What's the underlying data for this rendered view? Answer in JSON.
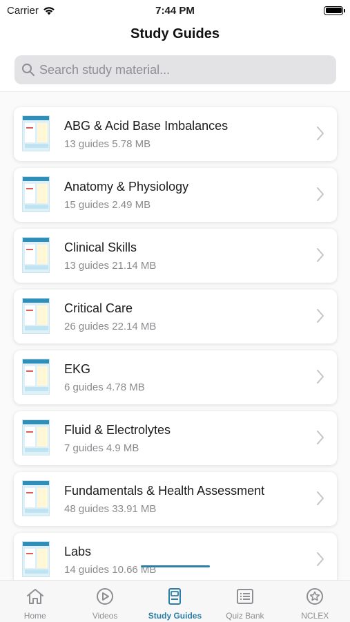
{
  "status": {
    "carrier": "Carrier",
    "time": "7:44 PM"
  },
  "header": {
    "title": "Study Guides"
  },
  "search": {
    "placeholder": "Search study material..."
  },
  "categories": [
    {
      "title": "ABG & Acid Base Imbalances",
      "subtitle": "13 guides 5.78 MB"
    },
    {
      "title": "Anatomy & Physiology",
      "subtitle": "15 guides 2.49 MB"
    },
    {
      "title": "Clinical Skills",
      "subtitle": "13 guides 21.14 MB"
    },
    {
      "title": "Critical Care",
      "subtitle": "26 guides 22.14 MB"
    },
    {
      "title": "EKG",
      "subtitle": "6 guides 4.78 MB"
    },
    {
      "title": "Fluid & Electrolytes",
      "subtitle": "7 guides 4.9 MB"
    },
    {
      "title": "Fundamentals & Health Assessment",
      "subtitle": "48 guides 33.91 MB"
    },
    {
      "title": "Labs",
      "subtitle": "14 guides 10.66 MB"
    }
  ],
  "tabs": [
    {
      "label": "Home",
      "icon": "home-icon"
    },
    {
      "label": "Videos",
      "icon": "play-icon"
    },
    {
      "label": "Study Guides",
      "icon": "study-guide-icon",
      "active": true
    },
    {
      "label": "Quiz Bank",
      "icon": "list-icon"
    },
    {
      "label": "NCLEX",
      "icon": "star-badge-icon"
    }
  ],
  "colors": {
    "accent": "#2a7ea8",
    "inactive": "#8e8e93"
  }
}
